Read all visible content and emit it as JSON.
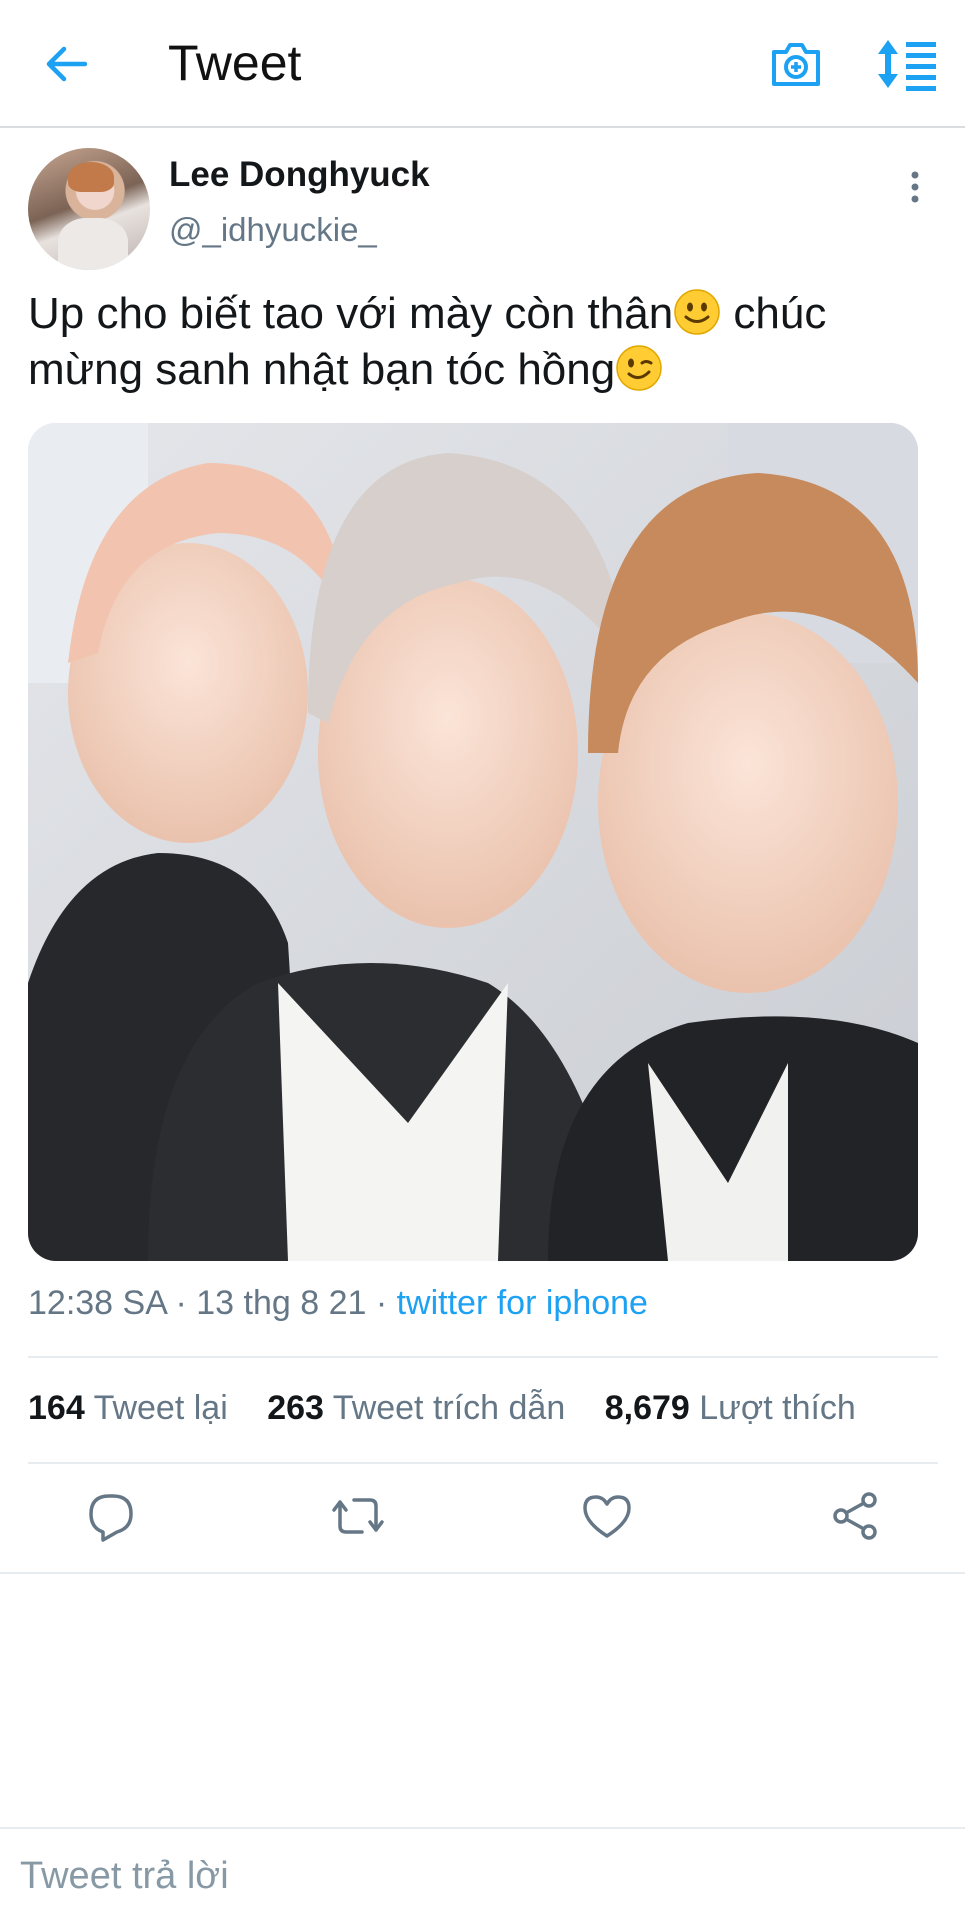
{
  "header": {
    "title": "Tweet",
    "back_icon": "back-arrow-icon",
    "camera_icon": "camera-icon",
    "sort_icon": "sort-list-icon",
    "accent_color": "#1da1f2"
  },
  "tweet": {
    "author_name": "Lee Donghyuck",
    "author_handle": "@_idhyuckie_",
    "more_icon": "more-vertical-icon",
    "text_line1": "Up cho biết tao với mày còn thân",
    "text_line1b": " chúc",
    "text_line2": "mừng sanh nhật bạn tóc hồng",
    "emoji1": "slightly-smiling-face-emoji",
    "emoji2": "winking-face-emoji",
    "photo": "group-selfie-photo",
    "time": "12:38 SA",
    "separator": " · ",
    "date": "13 thg 8 21",
    "source": "twitter for iphone"
  },
  "stats": {
    "retweets_count": "164",
    "retweets_label": "Tweet lại",
    "quotes_count": "263",
    "quotes_label": "Tweet trích dẫn",
    "likes_count": "8,679",
    "likes_label": "Lượt thích"
  },
  "actions": [
    "reply-icon",
    "retweet-icon",
    "like-icon",
    "share-icon"
  ],
  "composer": {
    "placeholder": "Tweet trả lời"
  }
}
